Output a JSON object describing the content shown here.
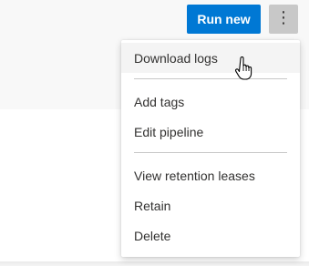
{
  "toolbar": {
    "run_label": "Run new",
    "more_icon": "more-vertical-icon"
  },
  "menu": {
    "items": [
      {
        "label": "Download logs",
        "hovered": true
      },
      {
        "label": "Add tags"
      },
      {
        "label": "Edit pipeline"
      },
      {
        "label": "View retention leases"
      },
      {
        "label": "Retain"
      },
      {
        "label": "Delete"
      }
    ]
  },
  "colors": {
    "primary": "#0078d4",
    "menu_hover": "#f4f4f4",
    "text": "#323130"
  },
  "cursor": "hand-pointer-icon"
}
